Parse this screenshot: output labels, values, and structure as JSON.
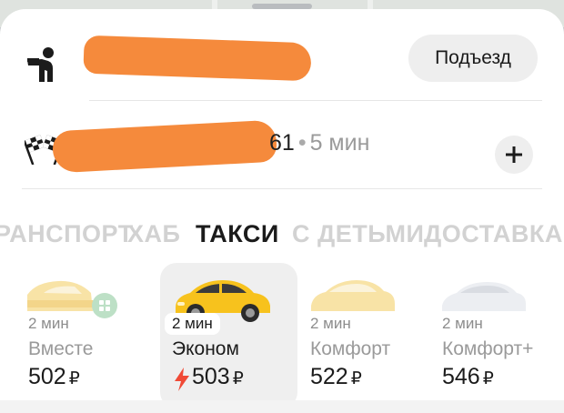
{
  "route": {
    "pickup": {
      "entrance_label": "Подъезд"
    },
    "destination": {
      "suffix_text": "61",
      "eta": "5 мин",
      "separator": "•"
    }
  },
  "service_tabs": [
    {
      "label": "РАНСПОРТ",
      "active": false
    },
    {
      "label": "ХАБ",
      "active": false
    },
    {
      "label": "ТАКСИ",
      "active": true
    },
    {
      "label": "С ДЕТЬМИ",
      "active": false
    },
    {
      "label": "ДОСТАВКА",
      "active": false
    }
  ],
  "tariffs": [
    {
      "eta": "2 мин",
      "name": "Вместе",
      "price": "502",
      "currency": "₽",
      "selected": false
    },
    {
      "eta": "2 мин",
      "name": "Эконом",
      "price": "503",
      "currency": "₽",
      "selected": true,
      "surge": true
    },
    {
      "eta": "2 мин",
      "name": "Комфорт",
      "price": "522",
      "currency": "₽",
      "selected": false
    },
    {
      "eta": "2 мин",
      "name": "Комфорт+",
      "price": "546",
      "currency": "₽",
      "selected": false
    }
  ],
  "colors": {
    "accent_yellow": "#f7c21d",
    "surge_red": "#f04a36",
    "redaction": "#f58a3c"
  }
}
